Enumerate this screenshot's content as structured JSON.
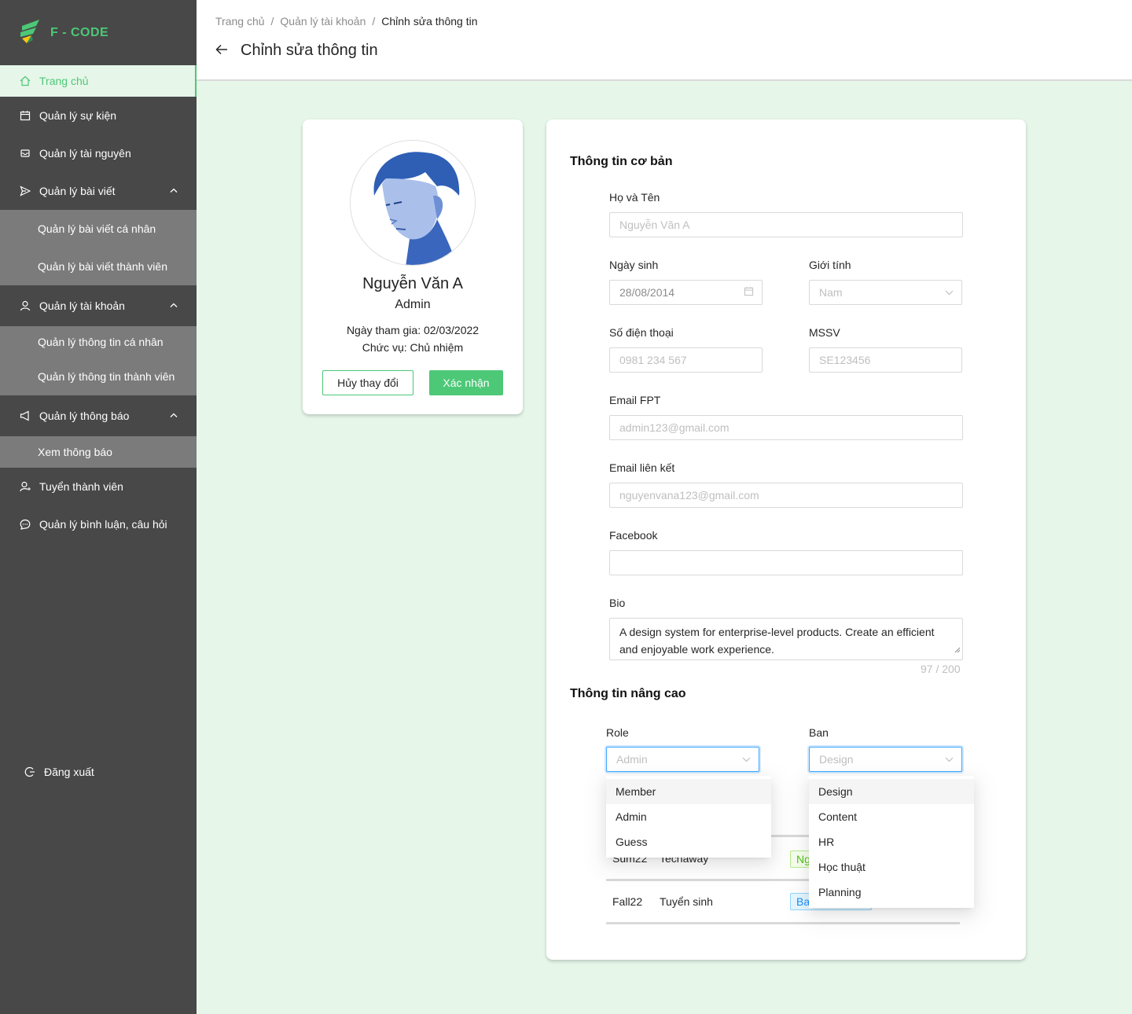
{
  "brand": {
    "name": "F - CODE"
  },
  "sidebar": {
    "items": [
      {
        "label": "Trang chủ",
        "icon": "home-icon"
      },
      {
        "label": "Quản lý sự kiện",
        "icon": "calendar-icon"
      },
      {
        "label": "Quản lý tài nguyên",
        "icon": "inbox-icon"
      },
      {
        "label": "Quản lý bài viết",
        "icon": "send-icon",
        "sub": [
          "Quản lý bài viết cá nhân",
          "Quản lý bài viết thành viên"
        ]
      },
      {
        "label": "Quản lý tài khoản",
        "icon": "user-icon",
        "sub": [
          "Quản lý thông tin cá nhân",
          "Quản lý thông tin thành viên"
        ]
      },
      {
        "label": "Quản lý thông báo",
        "icon": "megaphone-icon",
        "sub": [
          "Xem thông báo"
        ]
      },
      {
        "label": "Tuyển thành viên",
        "icon": "user-add-icon"
      },
      {
        "label": "Quản lý bình luận, câu hỏi",
        "icon": "comment-icon"
      }
    ],
    "logout": "Đăng xuất"
  },
  "header": {
    "breadcrumb": [
      "Trang chủ",
      "Quản lý tài khoản",
      "Chỉnh sửa thông tin"
    ],
    "title": "Chỉnh sửa thông tin"
  },
  "profile": {
    "name": "Nguyễn Văn A",
    "role": "Admin",
    "joined": "Ngày tham gia: 02/03/2022",
    "position": "Chức vụ: Chủ nhiệm",
    "cancel_label": "Hủy thay đổi",
    "confirm_label": "Xác nhận"
  },
  "form": {
    "basic_title": "Thông tin cơ bản",
    "fullname": {
      "label": "Họ và Tên",
      "placeholder": "Nguyễn Văn A"
    },
    "dob": {
      "label": "Ngày sinh",
      "value": "28/08/2014"
    },
    "gender": {
      "label": "Giới tính",
      "value": "Nam"
    },
    "phone": {
      "label": "Số điện thoại",
      "value": "0981 234 567"
    },
    "mssv": {
      "label": "MSSV",
      "value": "SE123456"
    },
    "email_fpt": {
      "label": "Email FPT",
      "value": "admin123@gmail.com"
    },
    "email_link": {
      "label": "Email liên kết",
      "value": "nguyenvana123@gmail.com"
    },
    "facebook": {
      "label": "Facebook",
      "value": ""
    },
    "bio": {
      "label": "Bio",
      "value": "A design system for enterprise-level products. Create an efficient and enjoyable work experience.",
      "counter": "97 / 200"
    },
    "advanced_title": "Thông tin nâng cao",
    "role": {
      "label": "Role",
      "value": "Admin",
      "options": [
        "Member",
        "Admin",
        "Guess"
      ]
    },
    "ban": {
      "label": "Ban",
      "value": "Design",
      "options": [
        "Design",
        "Content",
        "HR",
        "Học thuật",
        "Planning"
      ]
    }
  },
  "history": [
    {
      "term": "Sum22",
      "event": "Techaway",
      "tag": "Ng"
    },
    {
      "term": "Fall22",
      "event": "Tuyển sinh",
      "tag": "Ba"
    }
  ],
  "colors": {
    "accent": "#4cc877",
    "sidebar": "#484848",
    "submenu": "#7b7b7b",
    "background": "#e6f6e9"
  }
}
